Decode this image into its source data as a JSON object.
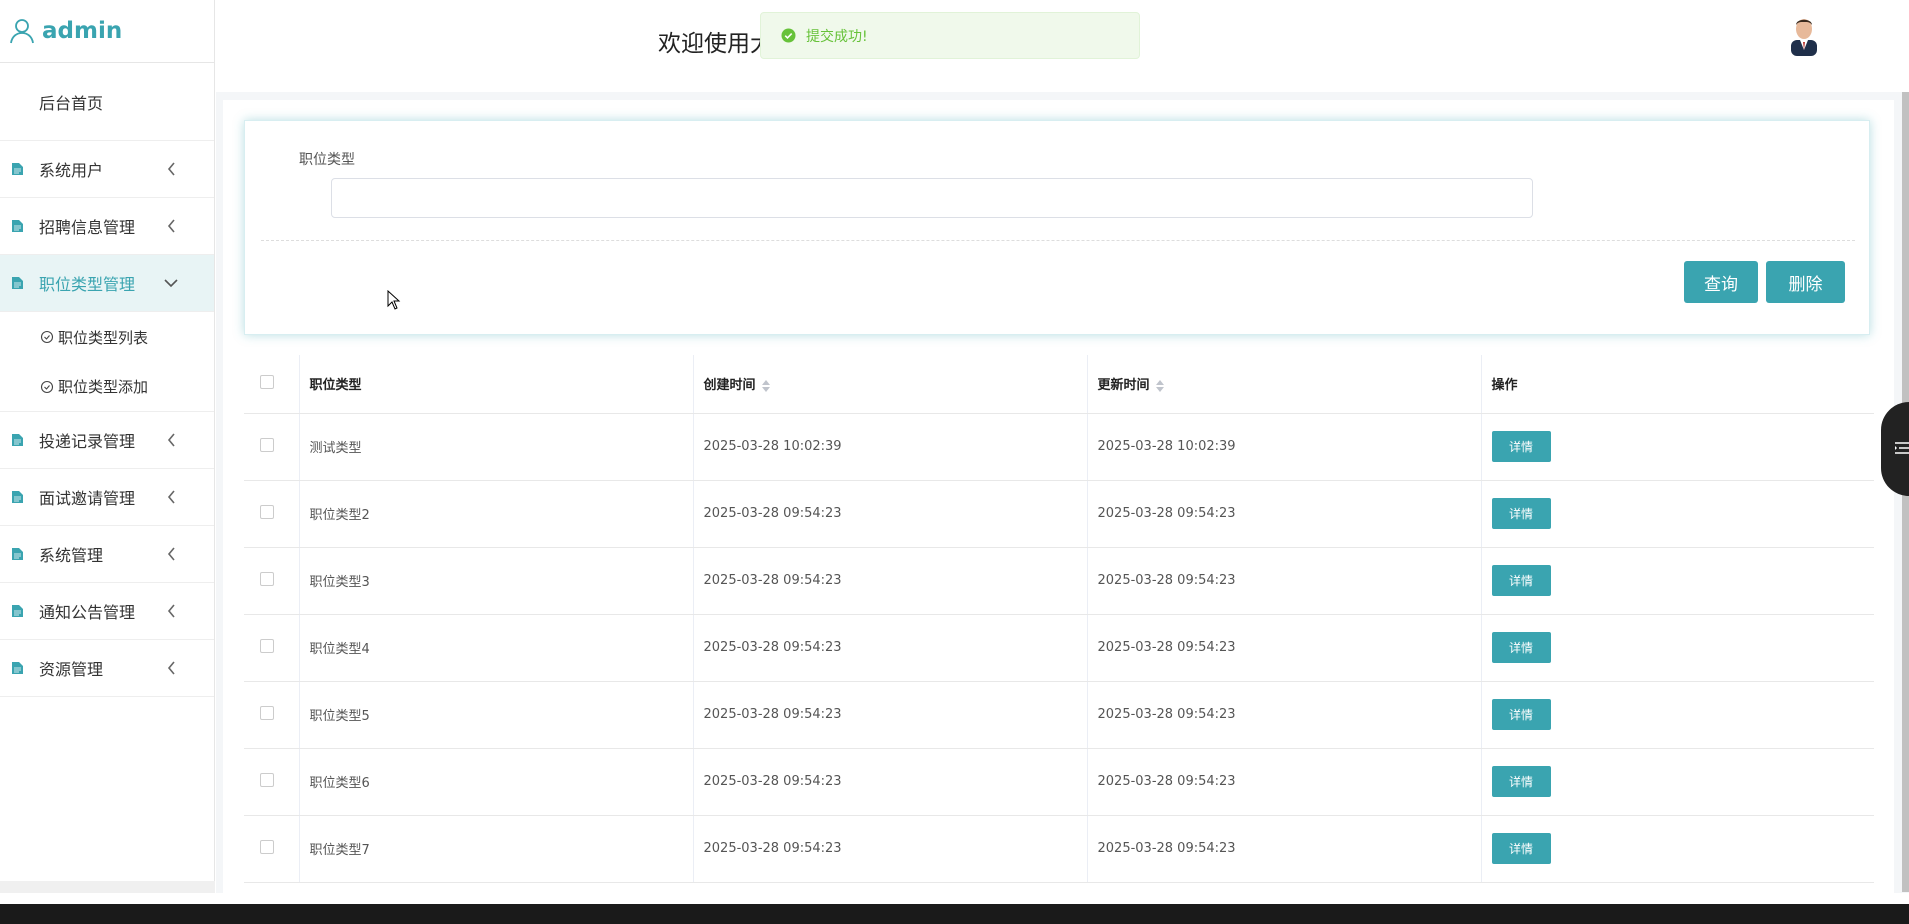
{
  "brand": {
    "username": "admin"
  },
  "header": {
    "welcome": "欢迎使用大",
    "toast": "提交成功!"
  },
  "sidebar": {
    "home": "后台首页",
    "items": [
      {
        "label": "系统用户"
      },
      {
        "label": "招聘信息管理"
      },
      {
        "label": "职位类型管理"
      },
      {
        "label": "投递记录管理"
      },
      {
        "label": "面试邀请管理"
      },
      {
        "label": "系统管理"
      },
      {
        "label": "通知公告管理"
      },
      {
        "label": "资源管理"
      }
    ],
    "sub": [
      {
        "label": "职位类型列表"
      },
      {
        "label": "职位类型添加"
      }
    ]
  },
  "filter": {
    "label": "职位类型",
    "query_label": "查询",
    "delete_label": "删除"
  },
  "table": {
    "headers": {
      "type": "职位类型",
      "created": "创建时间",
      "updated": "更新时间",
      "actions": "操作"
    },
    "detail_label": "详情",
    "rows": [
      {
        "type": "测试类型",
        "created": "2025-03-28 10:02:39",
        "updated": "2025-03-28 10:02:39"
      },
      {
        "type": "职位类型2",
        "created": "2025-03-28 09:54:23",
        "updated": "2025-03-28 09:54:23"
      },
      {
        "type": "职位类型3",
        "created": "2025-03-28 09:54:23",
        "updated": "2025-03-28 09:54:23"
      },
      {
        "type": "职位类型4",
        "created": "2025-03-28 09:54:23",
        "updated": "2025-03-28 09:54:23"
      },
      {
        "type": "职位类型5",
        "created": "2025-03-28 09:54:23",
        "updated": "2025-03-28 09:54:23"
      },
      {
        "type": "职位类型6",
        "created": "2025-03-28 09:54:23",
        "updated": "2025-03-28 09:54:23"
      },
      {
        "type": "职位类型7",
        "created": "2025-03-28 09:54:23",
        "updated": "2025-03-28 09:54:23"
      }
    ]
  }
}
